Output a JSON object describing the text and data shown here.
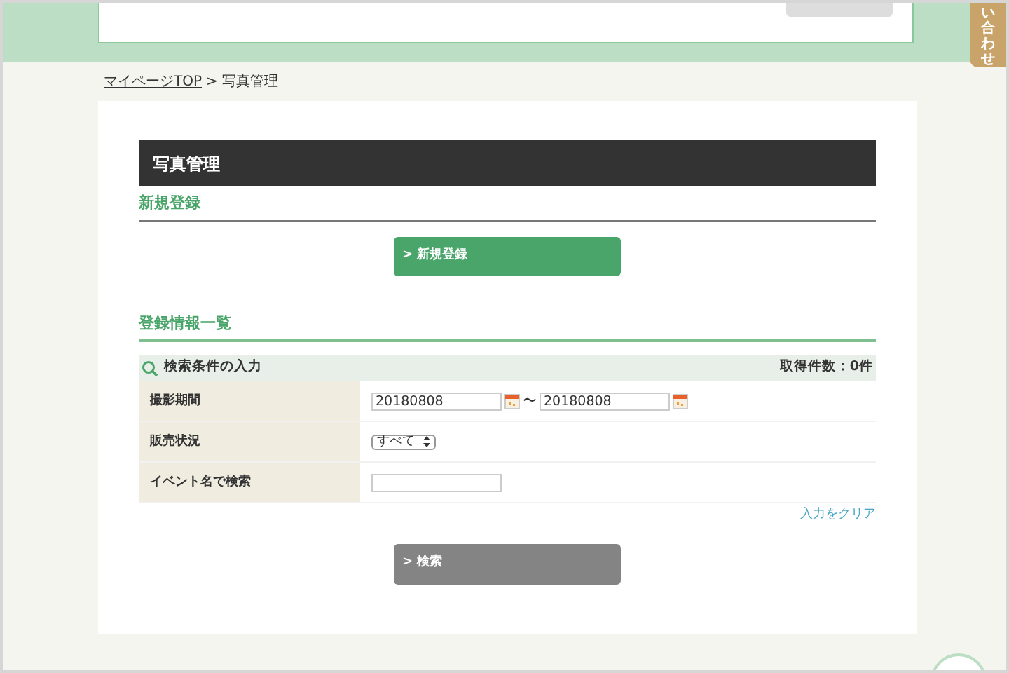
{
  "side_tab": {
    "label": "い合わせ"
  },
  "breadcrumb": [
    {
      "label": "マイページTOP",
      "link": true
    },
    {
      "label": ">",
      "link": false
    },
    {
      "label": "写真管理",
      "link": false
    }
  ],
  "page_title": "写真管理",
  "new_section": {
    "heading": "新規登録",
    "button": "> 新規登録"
  },
  "list_section": {
    "heading": "登録情報一覧"
  },
  "search_panel": {
    "title": "検索条件の入力",
    "count": "取得件数：0件"
  },
  "fields": [
    {
      "kind": "daterange",
      "label": "撮影期間",
      "from": "20180808",
      "separator": "〜",
      "to": "20180808"
    },
    {
      "kind": "select",
      "label": "販売状況",
      "value": "すべて"
    },
    {
      "kind": "text",
      "label": "イベント名で検索"
    }
  ],
  "clear_link": "入力をクリア",
  "search_button": {
    "label": "> 検索",
    "disabled": true
  }
}
